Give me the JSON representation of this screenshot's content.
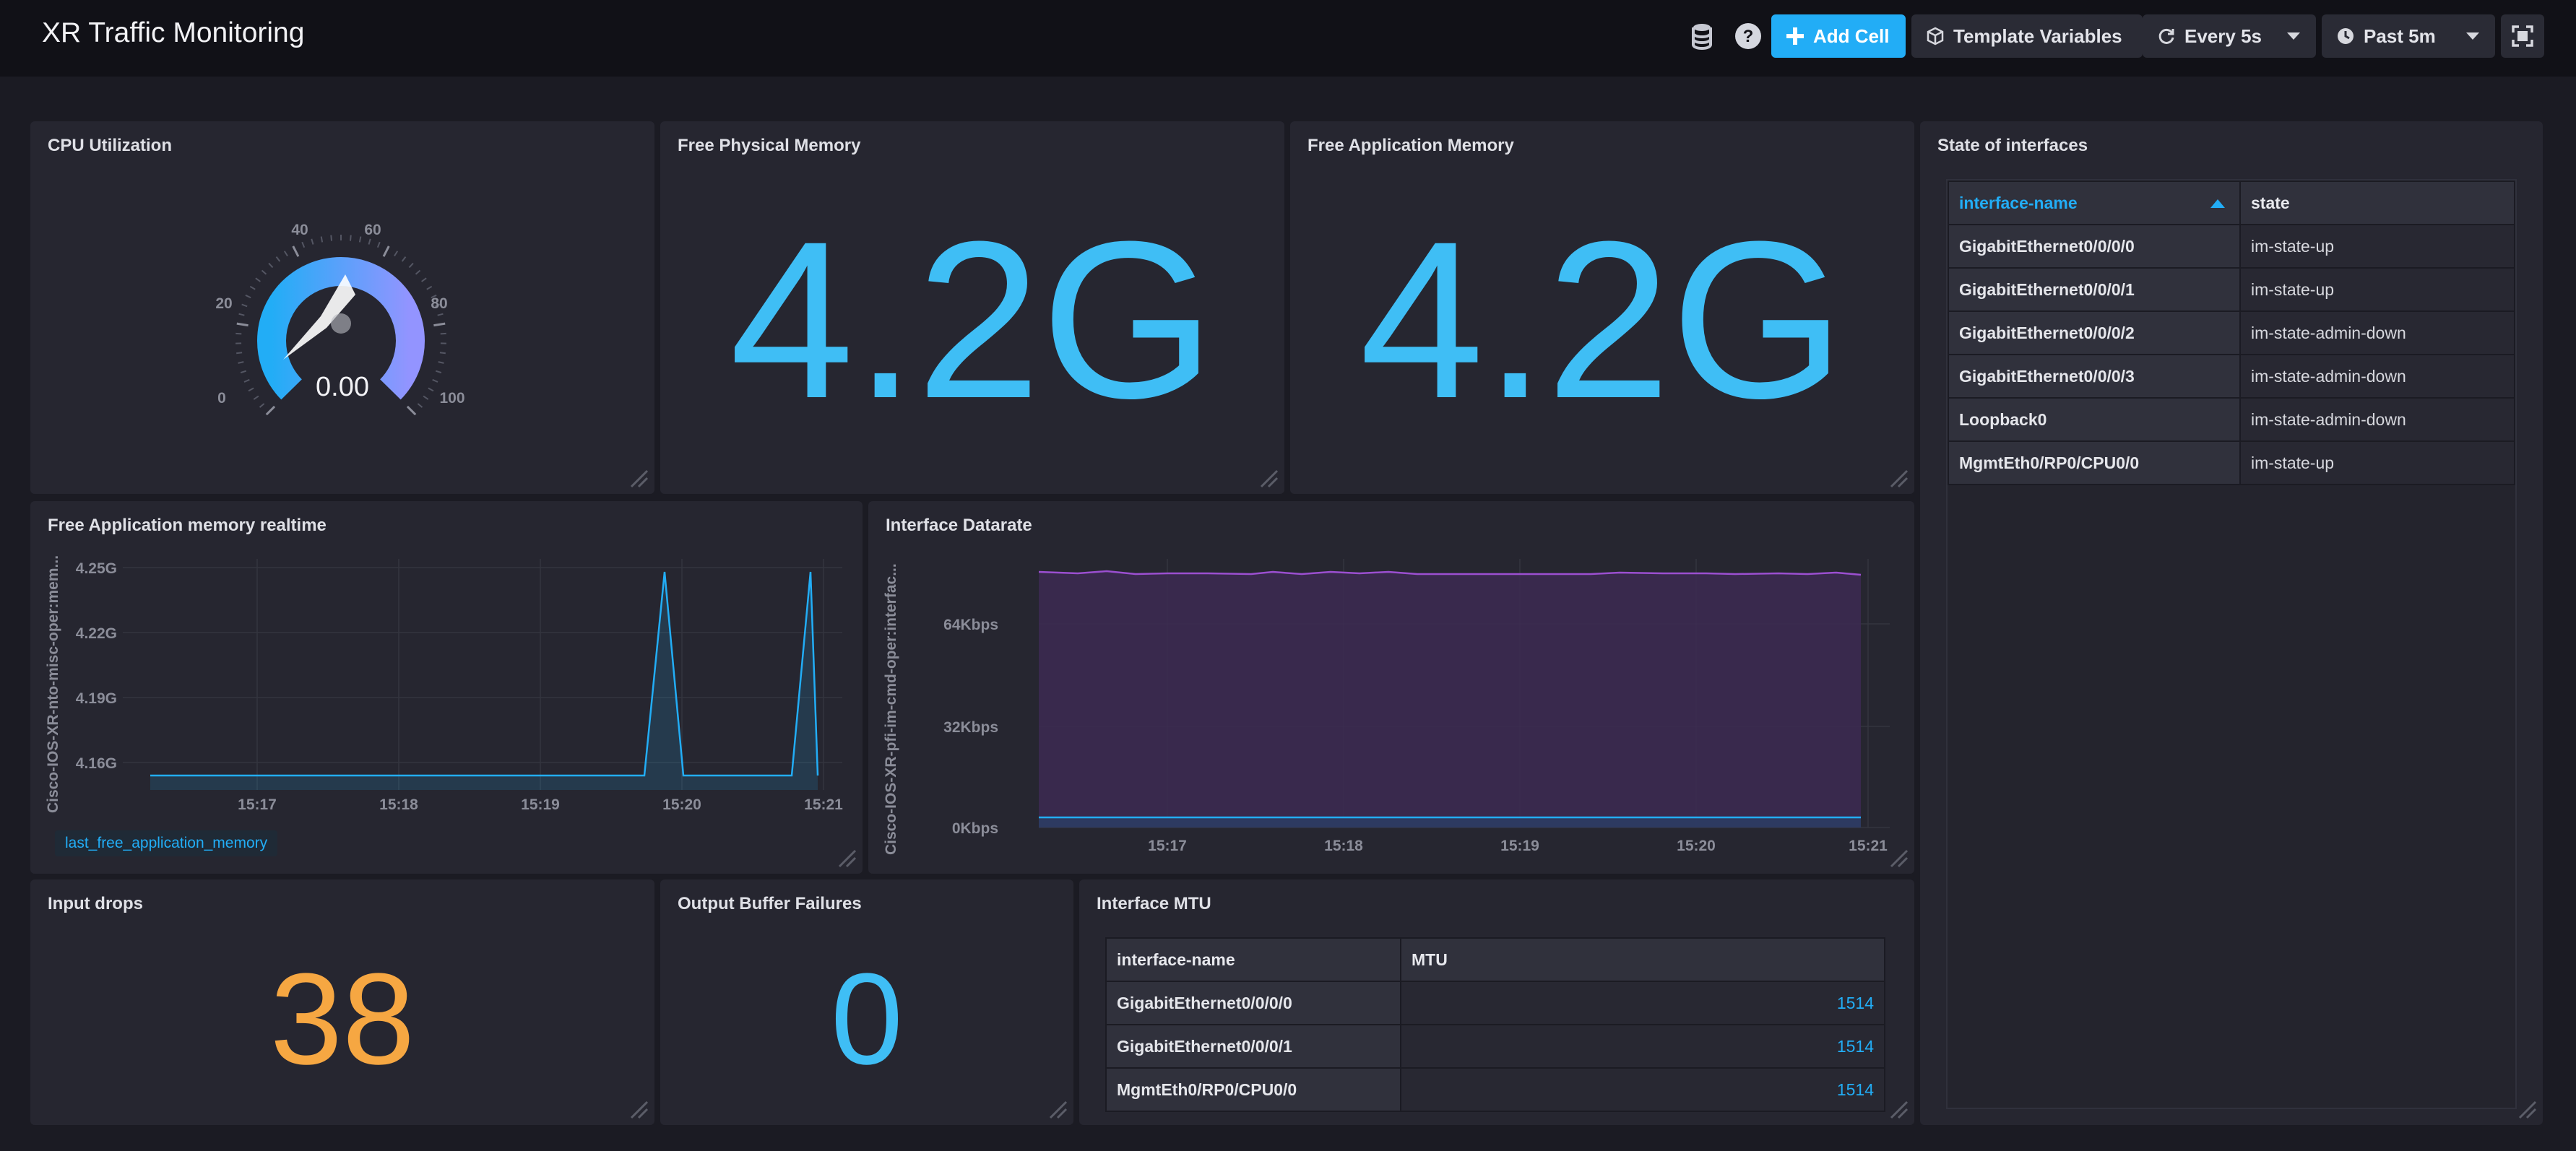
{
  "header": {
    "title": "XR Traffic Monitoring",
    "add_cell_label": "Add Cell",
    "template_variables_label": "Template Variables",
    "refresh_label": "Every 5s",
    "time_range_label": "Past 5m"
  },
  "cpu": {
    "title": "CPU Utilization",
    "value": "0.00",
    "ticks": [
      "0",
      "20",
      "40",
      "60",
      "80",
      "100"
    ]
  },
  "physical_memory": {
    "title": "Free Physical Memory",
    "value": "4.2G"
  },
  "application_memory": {
    "title": "Free Application Memory",
    "value": "4.2G"
  },
  "interfaces_state": {
    "title": "State of interfaces",
    "columns": [
      "interface-name",
      "state"
    ],
    "rows": [
      [
        "GigabitEthernet0/0/0/0",
        "im-state-up"
      ],
      [
        "GigabitEthernet0/0/0/1",
        "im-state-up"
      ],
      [
        "GigabitEthernet0/0/0/2",
        "im-state-admin-down"
      ],
      [
        "GigabitEthernet0/0/0/3",
        "im-state-admin-down"
      ],
      [
        "Loopback0",
        "im-state-admin-down"
      ],
      [
        "MgmtEth0/RP0/CPU0/0",
        "im-state-up"
      ]
    ]
  },
  "memory_realtime": {
    "title": "Free Application memory realtime",
    "ylabel": "Cisco-IOS-XR-nto-misc-oper:mem...",
    "legend": "last_free_application_memory",
    "yticks": [
      "4.25G",
      "4.22G",
      "4.19G",
      "4.16G"
    ],
    "xticks": [
      "15:17",
      "15:18",
      "15:19",
      "15:20",
      "15:21"
    ]
  },
  "datarate": {
    "title": "Interface Datarate",
    "ylabel": "Cisco-IOS-XR-pfi-im-cmd-oper:interfac...",
    "yticks": [
      "64Kbps",
      "32Kbps",
      "0Kbps"
    ],
    "xticks": [
      "15:17",
      "15:18",
      "15:19",
      "15:20",
      "15:21"
    ]
  },
  "input_drops": {
    "title": "Input drops",
    "value": "38"
  },
  "output_buffer": {
    "title": "Output Buffer Failures",
    "value": "0"
  },
  "mtu": {
    "title": "Interface MTU",
    "columns": [
      "interface-name",
      "MTU"
    ],
    "rows": [
      [
        "GigabitEthernet0/0/0/0",
        "1514"
      ],
      [
        "GigabitEthernet0/0/0/1",
        "1514"
      ],
      [
        "MgmtEth0/RP0/CPU0/0",
        "1514"
      ]
    ]
  },
  "colors": {
    "accent_blue": "#22adf6",
    "stat_blue": "#3fbef5",
    "stat_orange": "#f6a742",
    "purple": "#9b4fd0"
  },
  "icons": [
    "database-icon",
    "help-icon",
    "plus-icon",
    "cube-icon",
    "refresh-icon",
    "clock-icon",
    "fullscreen-icon",
    "resize-handle-icon"
  ]
}
